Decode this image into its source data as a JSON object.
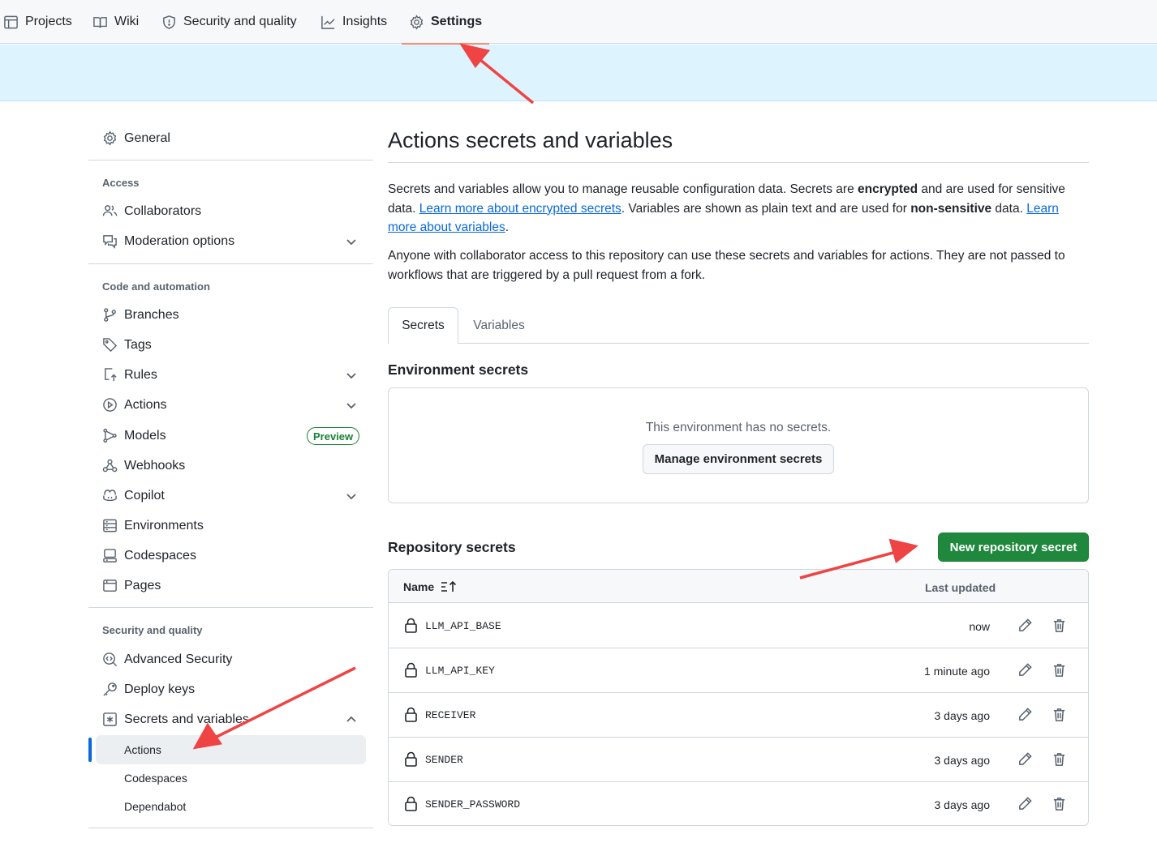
{
  "topnav": {
    "tabs": [
      {
        "label": "Projects",
        "icon": "table-icon"
      },
      {
        "label": "Wiki",
        "icon": "book-icon"
      },
      {
        "label": "Security and quality",
        "icon": "shield-icon"
      },
      {
        "label": "Insights",
        "icon": "graph-icon"
      },
      {
        "label": "Settings",
        "icon": "gear-icon",
        "active": true
      }
    ]
  },
  "sidebar": {
    "general": "General",
    "access_heading": "Access",
    "access": [
      "Collaborators",
      "Moderation options"
    ],
    "code_heading": "Code and automation",
    "code": [
      "Branches",
      "Tags",
      "Rules",
      "Actions",
      "Models",
      "Webhooks",
      "Copilot",
      "Environments",
      "Codespaces",
      "Pages"
    ],
    "preview_badge": "Preview",
    "security_heading": "Security and quality",
    "security": [
      "Advanced Security",
      "Deploy keys",
      "Secrets and variables"
    ],
    "secrets_sub": [
      "Actions",
      "Codespaces",
      "Dependabot"
    ]
  },
  "main": {
    "title": "Actions secrets and variables",
    "desc1_a": "Secrets and variables allow you to manage reusable configuration data. Secrets are ",
    "desc1_b": "encrypted",
    "desc1_c": " and are used for sensitive data. ",
    "desc1_link1": "Learn more about encrypted secrets",
    "desc1_d": ". Variables are shown as plain text and are used for ",
    "desc1_e": "non-sensitive",
    "desc1_f": " data. ",
    "desc1_link2": "Learn more about variables",
    "desc1_g": ".",
    "desc2": "Anyone with collaborator access to this repository can use these secrets and variables for actions. They are not passed to workflows that are triggered by a pull request from a fork.",
    "tabs": [
      "Secrets",
      "Variables"
    ],
    "env_heading": "Environment secrets",
    "env_empty": "This environment has no secrets.",
    "env_button": "Manage environment secrets",
    "repo_heading": "Repository secrets",
    "new_button": "New repository secret",
    "table": {
      "col_name": "Name",
      "col_updated": "Last updated",
      "rows": [
        {
          "name": "LLM_API_BASE",
          "updated": "now"
        },
        {
          "name": "LLM_API_KEY",
          "updated": "1 minute ago"
        },
        {
          "name": "RECEIVER",
          "updated": "3 days ago"
        },
        {
          "name": "SENDER",
          "updated": "3 days ago"
        },
        {
          "name": "SENDER_PASSWORD",
          "updated": "3 days ago"
        }
      ]
    }
  },
  "colors": {
    "accent": "#0969da",
    "primary_button": "#1f883d",
    "annotation_arrow": "#ef4444",
    "active_tab_underline": "#fd8c73"
  }
}
